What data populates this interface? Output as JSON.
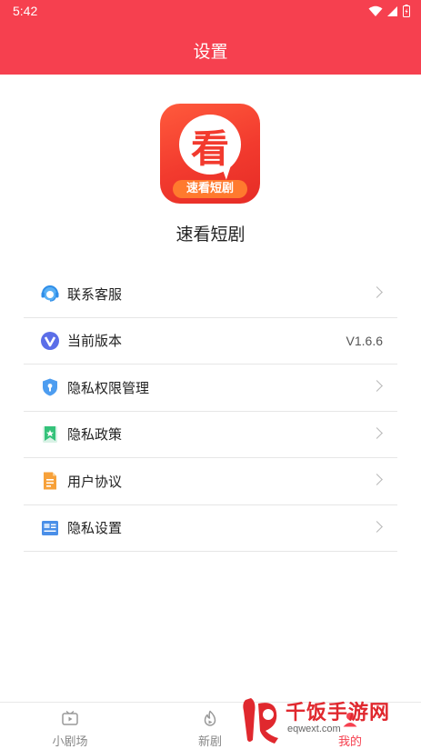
{
  "status_bar": {
    "time": "5:42",
    "icons": [
      "wifi-icon",
      "signal-icon",
      "battery-icon"
    ]
  },
  "header": {
    "title": "设置",
    "color": "#f6404f"
  },
  "app": {
    "logo_char": "看",
    "logo_banner": "速看短剧",
    "name": "速看短剧"
  },
  "menu": {
    "items": [
      {
        "label": "联系客服",
        "icon": "customer-service-icon",
        "value": "",
        "chevron": true
      },
      {
        "label": "当前版本",
        "icon": "version-icon",
        "value": "V1.6.6",
        "chevron": false
      },
      {
        "label": "隐私权限管理",
        "icon": "privacy-shield-icon",
        "value": "",
        "chevron": true
      },
      {
        "label": "隐私政策",
        "icon": "bookmark-icon",
        "value": "",
        "chevron": true
      },
      {
        "label": "用户协议",
        "icon": "document-icon",
        "value": "",
        "chevron": true
      },
      {
        "label": "隐私设置",
        "icon": "id-card-icon",
        "value": "",
        "chevron": true
      }
    ]
  },
  "tabbar": {
    "tabs": [
      {
        "label": "小剧场",
        "icon": "tv-icon",
        "active": false
      },
      {
        "label": "新剧",
        "icon": "flame-icon",
        "active": false
      },
      {
        "label": "我的",
        "icon": "profile-icon",
        "active": true
      }
    ]
  },
  "watermark": {
    "text": "千饭手游网",
    "url": "eqwext.com"
  },
  "colors": {
    "accent": "#f6404f",
    "divider": "#e6e6e6",
    "label": "#222222",
    "muted": "#888888"
  }
}
